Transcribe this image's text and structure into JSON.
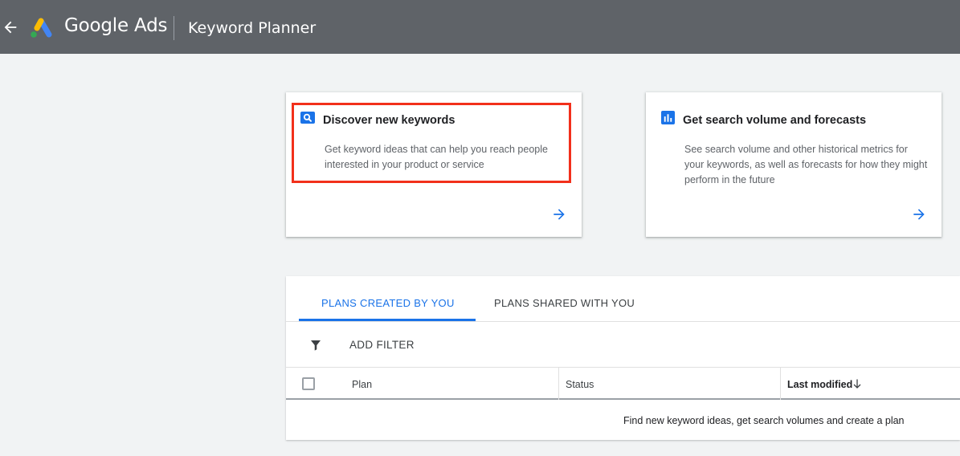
{
  "header": {
    "back_icon": "arrow-back-icon",
    "logo_icon": "google-ads-logo-icon",
    "brand": "Google Ads",
    "product": "Keyword Planner"
  },
  "cards": [
    {
      "icon": "search-icon",
      "title": "Discover new keywords",
      "description": "Get keyword ideas that can help you reach people interested in your product or service",
      "arrow_icon": "arrow-forward-icon",
      "highlighted": true
    },
    {
      "icon": "bar-chart-icon",
      "title": "Get search volume and forecasts",
      "description": "See search volume and other historical metrics for your keywords, as well as forecasts for how they might perform in the future",
      "arrow_icon": "arrow-forward-icon",
      "highlighted": false
    }
  ],
  "plans": {
    "tabs": [
      {
        "label": "PLANS CREATED BY YOU",
        "active": true
      },
      {
        "label": "PLANS SHARED WITH YOU",
        "active": false
      }
    ],
    "filter_icon": "filter-icon",
    "add_filter_label": "ADD FILTER",
    "columns": {
      "plan": "Plan",
      "status": "Status",
      "last_modified": "Last modified"
    },
    "sort_icon": "arrow-down-icon",
    "empty_message": "Find new keyword ideas, get search volumes and create a plan"
  },
  "colors": {
    "header_bg": "#5f6368",
    "accent": "#1a73e8",
    "highlight_border": "#f2301b",
    "page_bg": "#f1f3f4"
  }
}
